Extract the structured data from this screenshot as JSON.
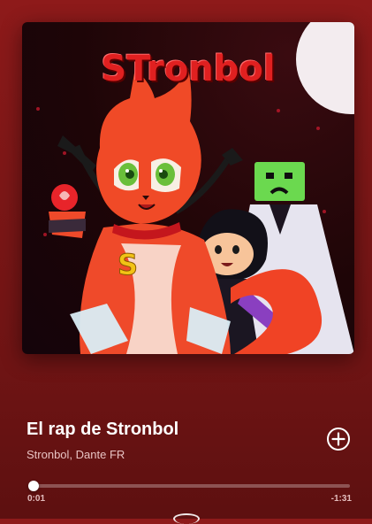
{
  "colors": {
    "background": "#7d1717",
    "accent": "#ffffff",
    "secondary_text": "#e8c3c3",
    "cover_title": "#e02020"
  },
  "cover": {
    "title_text": "STronbol"
  },
  "track": {
    "title": "El rap de Stronbol",
    "artists": "Stronbol, Dante FR"
  },
  "actions": {
    "add_icon": "plus-circle-icon"
  },
  "playback": {
    "elapsed": "0:01",
    "remaining": "-1:31",
    "progress_fraction": 0.0
  }
}
